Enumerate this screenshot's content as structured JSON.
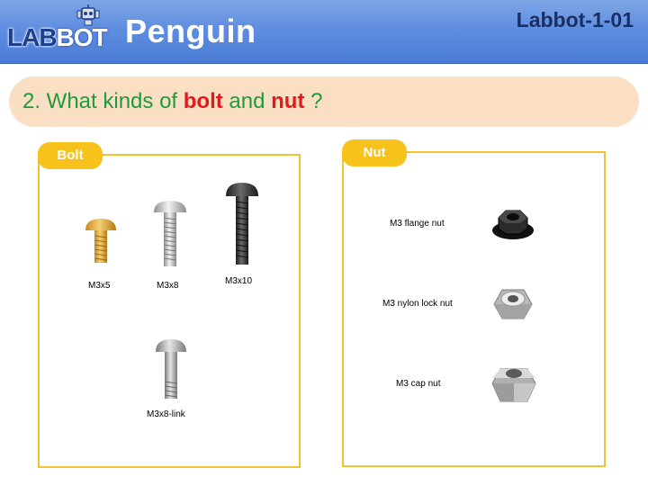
{
  "header": {
    "logo_text_a": "LAB",
    "logo_text_b": "BOT",
    "title": "Penguin",
    "code": "Labbot-1-01"
  },
  "question": {
    "prefix": "2. What kinds of ",
    "word1": "bolt",
    "middle": " and ",
    "word2": "nut",
    "suffix": " ?"
  },
  "bolt_panel": {
    "tag": "Bolt",
    "items": [
      {
        "label": "M3x5",
        "color": "#e8a93a"
      },
      {
        "label": "M3x8",
        "color": "#c9c9c9"
      },
      {
        "label": "M3x10",
        "color": "#3a3a3a"
      },
      {
        "label": "M3x8-link",
        "color": "#a9a9a9"
      }
    ]
  },
  "nut_panel": {
    "tag": "Nut",
    "items": [
      {
        "label": "M3 flange nut",
        "color": "#222222"
      },
      {
        "label": "M3 nylon lock nut",
        "color": "#cfcfcf"
      },
      {
        "label": "M3 cap nut",
        "color": "#bdbdbd"
      }
    ]
  },
  "colors": {
    "header_blue": "#5f8ee0",
    "question_bg": "#fbdfc4",
    "question_green": "#1f9a3c",
    "highlight_red": "#e01b1b",
    "panel_border": "#f2c230",
    "tag_yellow": "#f7c21b"
  }
}
